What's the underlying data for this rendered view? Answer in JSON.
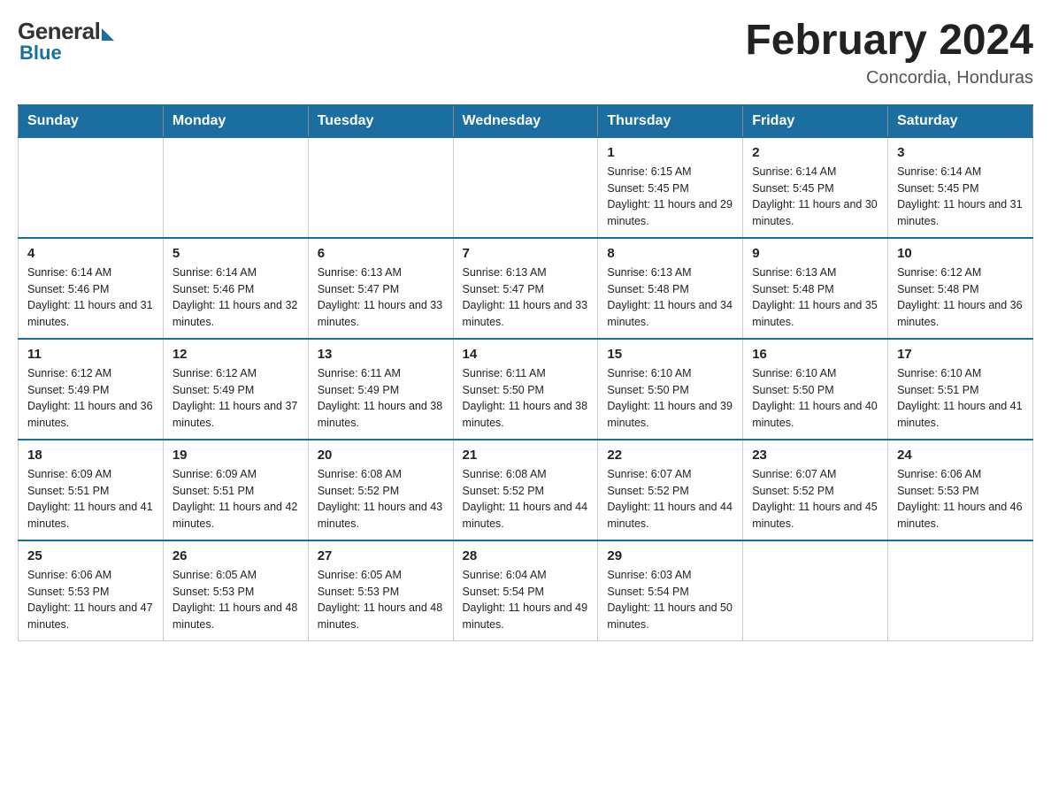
{
  "header": {
    "logo": {
      "general": "General",
      "blue": "Blue"
    },
    "title": "February 2024",
    "location": "Concordia, Honduras"
  },
  "weekdays": [
    "Sunday",
    "Monday",
    "Tuesday",
    "Wednesday",
    "Thursday",
    "Friday",
    "Saturday"
  ],
  "weeks": [
    [
      {
        "day": "",
        "info": ""
      },
      {
        "day": "",
        "info": ""
      },
      {
        "day": "",
        "info": ""
      },
      {
        "day": "",
        "info": ""
      },
      {
        "day": "1",
        "info": "Sunrise: 6:15 AM\nSunset: 5:45 PM\nDaylight: 11 hours and 29 minutes."
      },
      {
        "day": "2",
        "info": "Sunrise: 6:14 AM\nSunset: 5:45 PM\nDaylight: 11 hours and 30 minutes."
      },
      {
        "day": "3",
        "info": "Sunrise: 6:14 AM\nSunset: 5:45 PM\nDaylight: 11 hours and 31 minutes."
      }
    ],
    [
      {
        "day": "4",
        "info": "Sunrise: 6:14 AM\nSunset: 5:46 PM\nDaylight: 11 hours and 31 minutes."
      },
      {
        "day": "5",
        "info": "Sunrise: 6:14 AM\nSunset: 5:46 PM\nDaylight: 11 hours and 32 minutes."
      },
      {
        "day": "6",
        "info": "Sunrise: 6:13 AM\nSunset: 5:47 PM\nDaylight: 11 hours and 33 minutes."
      },
      {
        "day": "7",
        "info": "Sunrise: 6:13 AM\nSunset: 5:47 PM\nDaylight: 11 hours and 33 minutes."
      },
      {
        "day": "8",
        "info": "Sunrise: 6:13 AM\nSunset: 5:48 PM\nDaylight: 11 hours and 34 minutes."
      },
      {
        "day": "9",
        "info": "Sunrise: 6:13 AM\nSunset: 5:48 PM\nDaylight: 11 hours and 35 minutes."
      },
      {
        "day": "10",
        "info": "Sunrise: 6:12 AM\nSunset: 5:48 PM\nDaylight: 11 hours and 36 minutes."
      }
    ],
    [
      {
        "day": "11",
        "info": "Sunrise: 6:12 AM\nSunset: 5:49 PM\nDaylight: 11 hours and 36 minutes."
      },
      {
        "day": "12",
        "info": "Sunrise: 6:12 AM\nSunset: 5:49 PM\nDaylight: 11 hours and 37 minutes."
      },
      {
        "day": "13",
        "info": "Sunrise: 6:11 AM\nSunset: 5:49 PM\nDaylight: 11 hours and 38 minutes."
      },
      {
        "day": "14",
        "info": "Sunrise: 6:11 AM\nSunset: 5:50 PM\nDaylight: 11 hours and 38 minutes."
      },
      {
        "day": "15",
        "info": "Sunrise: 6:10 AM\nSunset: 5:50 PM\nDaylight: 11 hours and 39 minutes."
      },
      {
        "day": "16",
        "info": "Sunrise: 6:10 AM\nSunset: 5:50 PM\nDaylight: 11 hours and 40 minutes."
      },
      {
        "day": "17",
        "info": "Sunrise: 6:10 AM\nSunset: 5:51 PM\nDaylight: 11 hours and 41 minutes."
      }
    ],
    [
      {
        "day": "18",
        "info": "Sunrise: 6:09 AM\nSunset: 5:51 PM\nDaylight: 11 hours and 41 minutes."
      },
      {
        "day": "19",
        "info": "Sunrise: 6:09 AM\nSunset: 5:51 PM\nDaylight: 11 hours and 42 minutes."
      },
      {
        "day": "20",
        "info": "Sunrise: 6:08 AM\nSunset: 5:52 PM\nDaylight: 11 hours and 43 minutes."
      },
      {
        "day": "21",
        "info": "Sunrise: 6:08 AM\nSunset: 5:52 PM\nDaylight: 11 hours and 44 minutes."
      },
      {
        "day": "22",
        "info": "Sunrise: 6:07 AM\nSunset: 5:52 PM\nDaylight: 11 hours and 44 minutes."
      },
      {
        "day": "23",
        "info": "Sunrise: 6:07 AM\nSunset: 5:52 PM\nDaylight: 11 hours and 45 minutes."
      },
      {
        "day": "24",
        "info": "Sunrise: 6:06 AM\nSunset: 5:53 PM\nDaylight: 11 hours and 46 minutes."
      }
    ],
    [
      {
        "day": "25",
        "info": "Sunrise: 6:06 AM\nSunset: 5:53 PM\nDaylight: 11 hours and 47 minutes."
      },
      {
        "day": "26",
        "info": "Sunrise: 6:05 AM\nSunset: 5:53 PM\nDaylight: 11 hours and 48 minutes."
      },
      {
        "day": "27",
        "info": "Sunrise: 6:05 AM\nSunset: 5:53 PM\nDaylight: 11 hours and 48 minutes."
      },
      {
        "day": "28",
        "info": "Sunrise: 6:04 AM\nSunset: 5:54 PM\nDaylight: 11 hours and 49 minutes."
      },
      {
        "day": "29",
        "info": "Sunrise: 6:03 AM\nSunset: 5:54 PM\nDaylight: 11 hours and 50 minutes."
      },
      {
        "day": "",
        "info": ""
      },
      {
        "day": "",
        "info": ""
      }
    ]
  ]
}
